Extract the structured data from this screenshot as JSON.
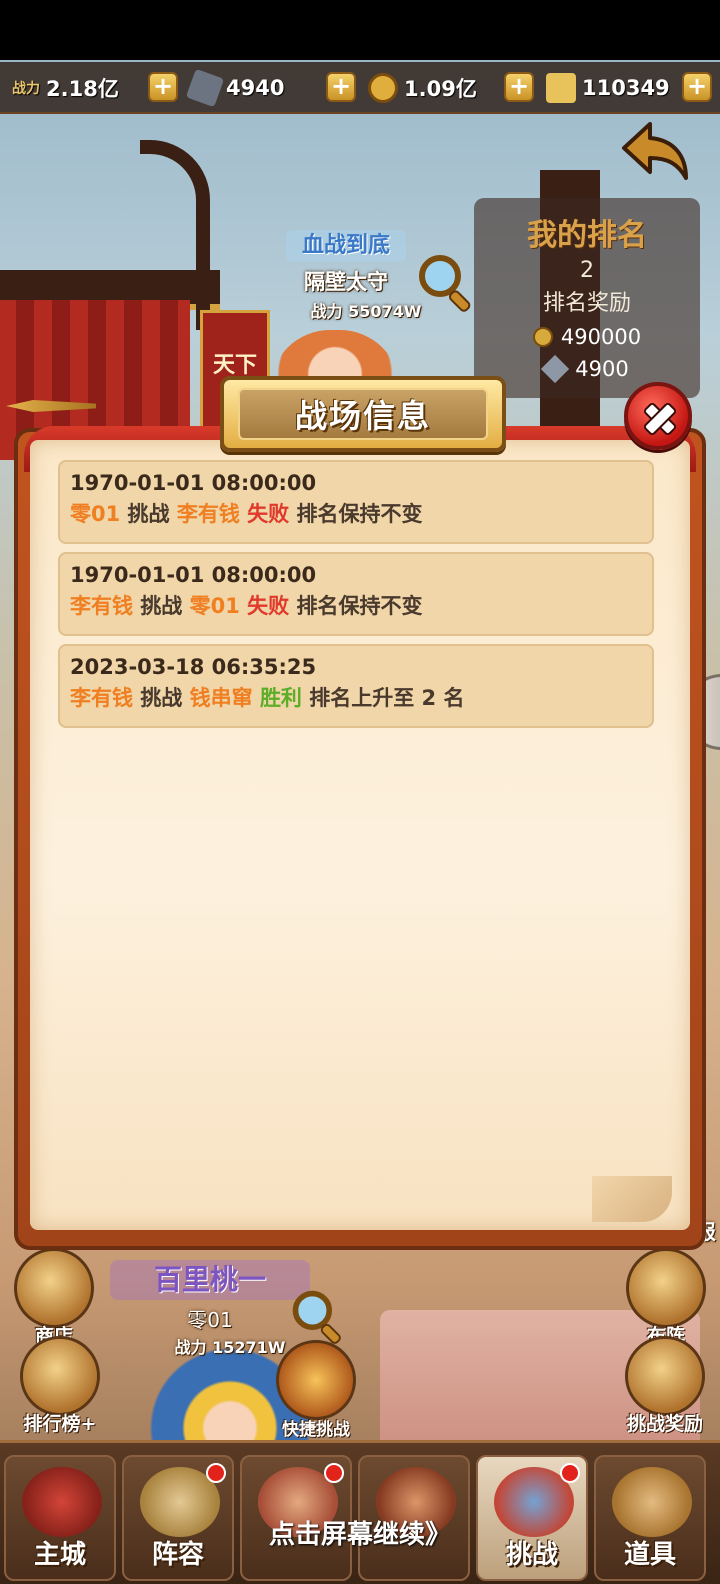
{
  "status_bar": {
    "power_label": "战力",
    "power_value": "2.18亿",
    "gems": "4940",
    "coins": "1.09亿",
    "honor": "110349",
    "plus_symbol": "+"
  },
  "my_rank": {
    "title": "我的排名",
    "rank": "2",
    "reward_label": "排名奖励",
    "coin_reward": "490000",
    "gem_reward": "4900"
  },
  "top_opponent": {
    "title": "血战到底",
    "name": "隔壁太守",
    "power": "战力  55074W",
    "banner": "天下第"
  },
  "dialog": {
    "title": "战场信息",
    "records": [
      {
        "time": "1970-01-01 08:00:00",
        "attacker": "零01",
        "verb": "挑战",
        "defender": "李有钱",
        "result": "失败",
        "result_type": "lose",
        "effect": "排名保持不变"
      },
      {
        "time": "1970-01-01 08:00:00",
        "attacker": "李有钱",
        "verb": "挑战",
        "defender": "零01",
        "result": "失败",
        "result_type": "lose",
        "effect": "排名保持不变"
      },
      {
        "time": "2023-03-18 06:35:25",
        "attacker": "李有钱",
        "verb": "挑战",
        "defender": "钱串窜",
        "result": "胜利",
        "result_type": "win",
        "effect": "排名上升至 2 名"
      }
    ]
  },
  "player": {
    "title": "百里桃一",
    "name": "零01",
    "power": "战力  15271W"
  },
  "side_buttons": {
    "shop": "商店",
    "leaderboard": "排行榜+",
    "quick_challenge": "快捷挑战",
    "formation": "布阵",
    "challenge_reward": "挑战奖励",
    "partial_right": "报"
  },
  "nav": {
    "items": [
      "主城",
      "阵容",
      "",
      "",
      "挑战",
      "道具"
    ]
  },
  "continue_hint": "点击屏幕继续》",
  "colors": {
    "attacker": "#f07f22",
    "lose": "#e0392b",
    "win": "#5cae28",
    "paper": "#fdf1de"
  }
}
